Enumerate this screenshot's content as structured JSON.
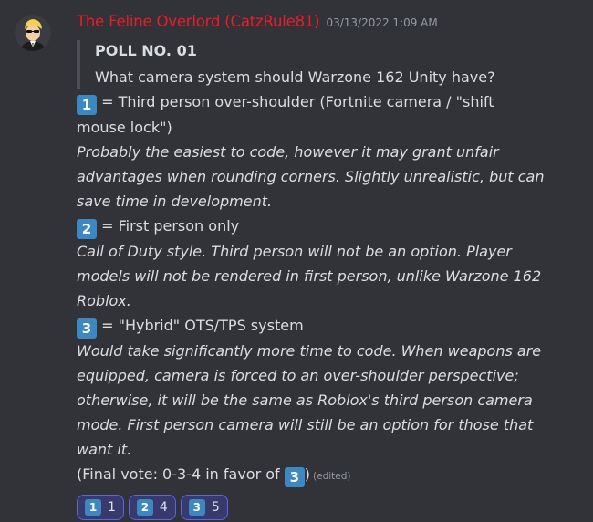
{
  "message": {
    "username": "The Feline Overlord (CatzRule81)",
    "timestamp": "03/13/2022 1:09 AM",
    "avatar": "avatar-icon",
    "quote": {
      "title": "POLL NO. 01",
      "question": "What camera system should Warzone 162 Unity have?"
    },
    "options": [
      {
        "key": "1",
        "label_lines": [
          "= Third person over-shoulder (Fortnite camera / \"shift",
          "mouse lock\")"
        ],
        "desc_lines": [
          "Probably the easiest to code, however it may grant unfair",
          "advantages when rounding corners. Slightly unrealistic, but can",
          "save time in development."
        ]
      },
      {
        "key": "2",
        "label_lines": [
          "= First person only"
        ],
        "desc_lines": [
          "Call of Duty style. Third person will not be an option. Player",
          "models will not be rendered in first person, unlike Warzone 162",
          "Roblox."
        ]
      },
      {
        "key": "3",
        "label_lines": [
          "= \"Hybrid\" OTS/TPS system"
        ],
        "desc_lines": [
          "Would take significantly more time to code. When weapons are",
          "equipped, camera is forced to an over-shoulder perspective;",
          "otherwise, it will be the same as Roblox's third person camera",
          "mode. First person camera will still be an option for those that",
          "want it."
        ]
      }
    ],
    "final_vote": {
      "prefix": "(Final vote: 0-3-4 in favor of",
      "key": "3",
      "suffix": ")",
      "edited": "(edited)"
    },
    "reactions": [
      {
        "key": "1",
        "count": "1"
      },
      {
        "key": "2",
        "count": "4"
      },
      {
        "key": "3",
        "count": "5"
      }
    ]
  },
  "colors": {
    "background": "#313338",
    "username": "#ed1c24",
    "keycap": "#3b88c3",
    "reaction_bg": "#383a6b",
    "reaction_border": "#5865f2"
  }
}
